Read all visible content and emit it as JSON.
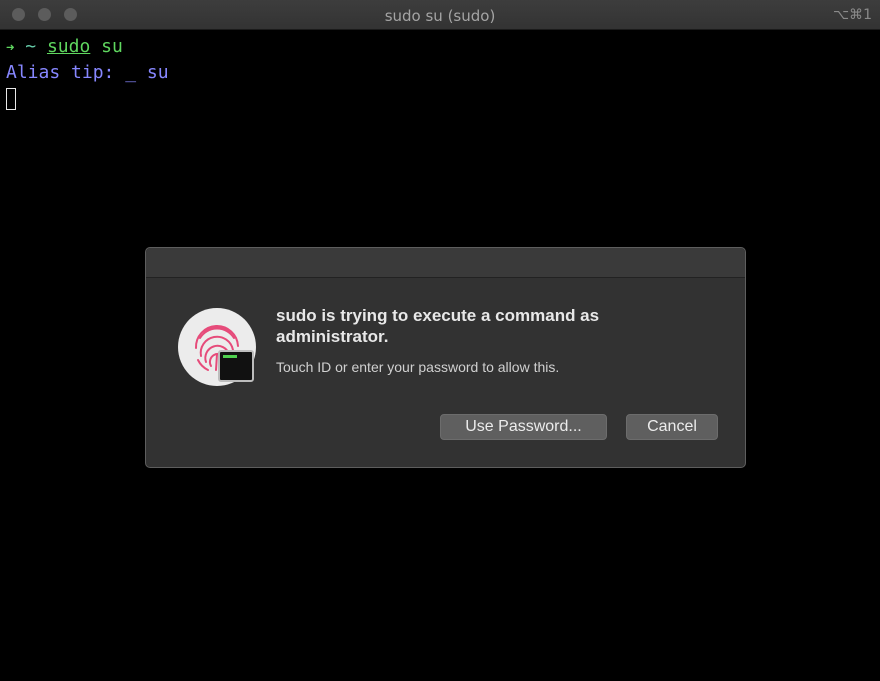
{
  "window": {
    "title": "sudo su (sudo)",
    "shortcut": "⌥⌘1"
  },
  "terminal": {
    "prompt_arrow": "➜",
    "prompt_dir": "~",
    "command_word": "sudo",
    "command_arg": " su",
    "alias_tip": "Alias tip: _ su"
  },
  "dialog": {
    "heading": "sudo is trying to execute a command as administrator.",
    "subtext": "Touch ID or enter your password to allow this.",
    "use_password_label": "Use Password...",
    "cancel_label": "Cancel"
  },
  "colors": {
    "fingerprint": "#e64b7a",
    "prompt_green": "#5fd75f",
    "alias_blue": "#8787ff"
  },
  "icons": [
    "fingerprint-icon",
    "terminal-icon"
  ]
}
